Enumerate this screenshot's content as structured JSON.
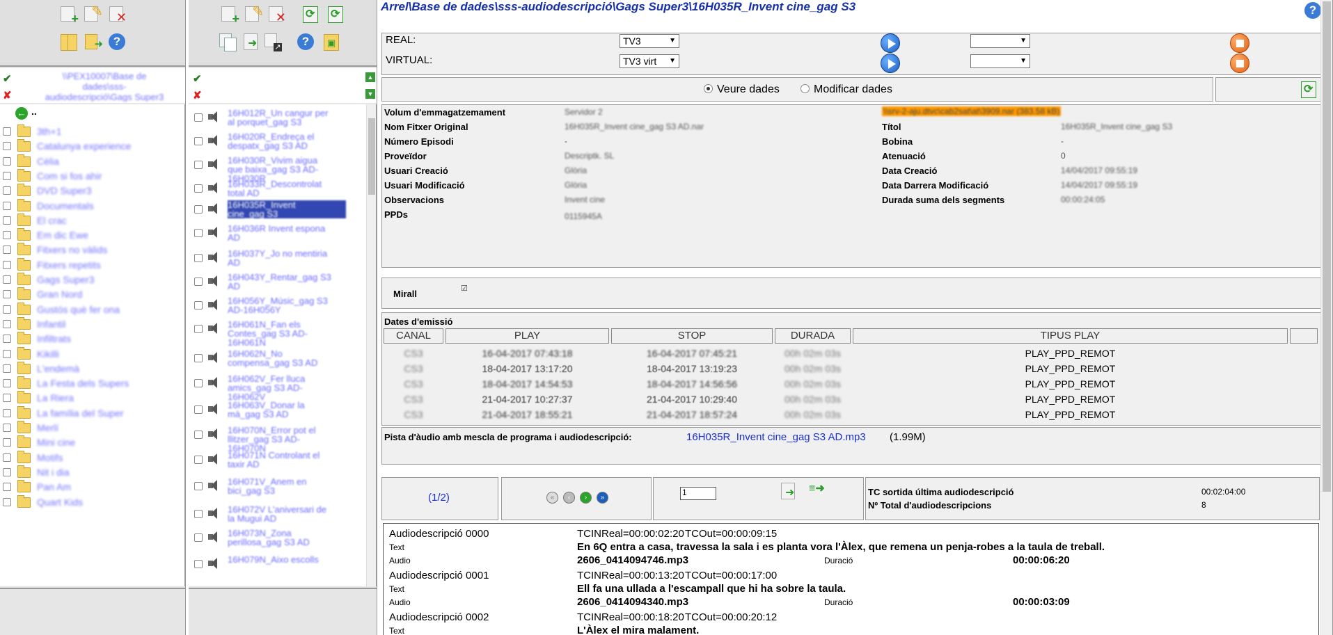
{
  "p1": {
    "root_path": "\\\\PEX10007\\Base de dades\\sss-audiodescripció\\Gags Super3",
    "back": "..",
    "folders": [
      "3th+1",
      "Catalunya experience",
      "Cèlia",
      "Com si fos ahir",
      "DVD Super3",
      "Documentals",
      "El crac",
      "Em dic Ewe",
      "Fitxers no vàlids",
      "Fitxers repetits",
      "Gags Super3",
      "Gran Nord",
      "Gustós què fer ona",
      "Infantil",
      "Infiltrats",
      "Kikilli",
      "L'endemà",
      "La Festa dels Supers",
      "La Riera",
      "La família del Super",
      "Merlí",
      "Mini cine",
      "Motifs",
      "Nit i dia",
      "Pan Am",
      "Quart Kids"
    ]
  },
  "p2": {
    "files": [
      {
        "lines": [
          "16H012R_Un cangur per",
          "al porquet_gag S3"
        ]
      },
      {
        "lines": [
          "16H020R_Endreça el",
          "despatx_gag S3 AD"
        ]
      },
      {
        "lines": [
          "16H030R_Vivim aigua",
          "que baixa_gag S3 AD-",
          "16H030R"
        ]
      },
      {
        "lines": [
          "16H033R_Descontrolat",
          "total AD"
        ]
      },
      {
        "lines": [
          "16H035R_Invent",
          "cine_gag S3"
        ],
        "selected": true
      },
      {
        "lines": [
          "16H036R Invent espona",
          "AD"
        ]
      },
      {
        "lines": [
          "16H037Y_Jo no mentiria",
          "AD"
        ]
      },
      {
        "lines": [
          "16H043Y_Rentar_gag S3",
          "AD"
        ]
      },
      {
        "lines": [
          "16H056Y_Músic_gag S3",
          "AD-16H056Y"
        ]
      },
      {
        "lines": [
          "16H061N_Fan els",
          "Contes_gag S3 AD-",
          "16H061N"
        ]
      },
      {
        "lines": [
          "16H062N_No",
          "compensa_gag S3 AD"
        ]
      },
      {
        "lines": [
          "16H062V_Fer lluca",
          "amics_gag S3 AD-",
          "16H062V"
        ]
      },
      {
        "lines": [
          "16H063V_Donar la",
          "mà_gag S3 AD"
        ]
      },
      {
        "lines": [
          "16H070N_Error pot el",
          "llitzer_gag S3 AD-",
          "16H070N"
        ]
      },
      {
        "lines": [
          "16H071N Controlant el",
          "taxir AD"
        ]
      },
      {
        "lines": [
          "16H071V_Anem en",
          "bici_gag S3"
        ]
      },
      {
        "lines": [
          "16H072V L'aniversari de",
          "la Mugui AD"
        ]
      },
      {
        "lines": [
          "16H073N_Zona",
          "perillosa_gag S3 AD"
        ]
      },
      {
        "lines": [
          "16H079N_Aixo escolls"
        ]
      }
    ]
  },
  "p3": {
    "breadcrumb": "Arrel\\Base de dades\\sss-audiodescripció\\Gags Super3\\16H035R_Invent cine_gag S3",
    "real_label": "REAL:",
    "real_channel": "TV3",
    "real_select2": "",
    "virtual_label": "VIRTUAL:",
    "virtual_channel": "TV3 virt",
    "virtual_select2": "",
    "view_data": "Veure dades",
    "modify_data": "Modificar dades",
    "fields_left": [
      {
        "k": "Volum d'emmagatzemament",
        "v": "Servidor 2",
        "blur": true
      },
      {
        "k": "Nom Fitxer Original",
        "v": "16H035R_Invent cine_gag S3 AD.nar",
        "blur": true
      },
      {
        "k": "Número Episodi",
        "v": "-",
        "blur": false
      },
      {
        "k": "Proveïdor",
        "v": "Descriptk. SL",
        "blur": true
      },
      {
        "k": "Usuari Creació",
        "v": "Glòria",
        "blur": true
      },
      {
        "k": "Usuari Modificació",
        "v": "Glòria",
        "blur": true
      },
      {
        "k": "Observacions",
        "v": "Invent cine",
        "blur": true
      },
      {
        "k": "PPDs",
        "v": "0115945A",
        "blur": true
      }
    ],
    "volume_path": "\\\\srv-2-aju.dtvc\\cab2sat\\at\\3909.nar (383.58 kB)",
    "fields_right": [
      {
        "k": "Títol",
        "v": "16H035R_Invent cine_gag S3",
        "blur": true
      },
      {
        "k": "Bobina",
        "v": "-",
        "blur": false
      },
      {
        "k": "Atenuació",
        "v": "0",
        "blur": false
      },
      {
        "k": "Data Creació",
        "v": "14/04/2017 09:55:19",
        "blur": true
      },
      {
        "k": "Data Darrera Modificació",
        "v": "14/04/2017 09:55:19",
        "blur": true
      },
      {
        "k": "Durada suma dels segments",
        "v": "00:00:24:05",
        "blur": true
      }
    ],
    "mirall": "Mirall",
    "emission_title": "Dates d'emissió",
    "emission_headers": [
      "CANAL",
      "PLAY",
      "STOP",
      "DURADA",
      "TIPUS PLAY",
      ""
    ],
    "emissions": [
      {
        "canal": "CS3",
        "play": "16-04-2017 07:43:18",
        "stop": "16-04-2017 07:45:21",
        "durada": "00h 02m 03s",
        "tipus": "PLAY_PPD_REMOT"
      },
      {
        "canal": "CS3",
        "play": "18-04-2017 13:17:20",
        "stop": "18-04-2017 13:19:23",
        "durada": "00h 02m 03s",
        "tipus": "PLAY_PPD_REMOT"
      },
      {
        "canal": "CS3",
        "play": "18-04-2017 14:54:53",
        "stop": "18-04-2017 14:56:56",
        "durada": "00h 02m 03s",
        "tipus": "PLAY_PPD_REMOT"
      },
      {
        "canal": "CS3",
        "play": "21-04-2017 10:27:37",
        "stop": "21-04-2017 10:29:40",
        "durada": "00h 02m 03s",
        "tipus": "PLAY_PPD_REMOT"
      },
      {
        "canal": "CS3",
        "play": "21-04-2017 18:55:21",
        "stop": "21-04-2017 18:57:24",
        "durada": "00h 02m 03s",
        "tipus": "PLAY_PPD_REMOT"
      }
    ],
    "track_label": "Pista d'àudio amb mescla de programa i audiodescripció:",
    "track_link": "16H035R_Invent cine_gag S3 AD.mp3",
    "track_size": "(1.99M)",
    "pager": "(1/2)",
    "page_input": "1",
    "tc_label": "TC sortida última audiodescripció",
    "tc_value": "00:02:04:00",
    "total_label": "Nº Total d'audiodescripcions",
    "total_value": "8",
    "ads": [
      {
        "title": "Audiodescripció 0000",
        "tcin": "TCINReal=00:00:02:20",
        "tcout": "TCOut=00:00:09:15",
        "text_label": "Text",
        "text": "En 6Q entra a casa, travessa la sala i es planta vora l'Àlex, que remena un penja-robes a la taula de treball.",
        "audio_label": "Audio",
        "audio": "2606_0414094746.mp3",
        "dur_label": "Duració",
        "dur": "00:00:06:20"
      },
      {
        "title": "Audiodescripció 0001",
        "tcin": "TCINReal=00:00:13:20",
        "tcout": "TCOut=00:00:17:00",
        "text_label": "Text",
        "text": "Ell fa una ullada a l'escampall que hi ha sobre la taula.",
        "audio_label": "Audio",
        "audio": "2606_0414094340.mp3",
        "dur_label": "Duració",
        "dur": "00:00:03:09"
      },
      {
        "title": "Audiodescripció 0002",
        "tcin": "TCINReal=00:00:18:20",
        "tcout": "TCOut=00:00:20:12",
        "text_label": "Text",
        "text": "L'Àlex el mira malament.",
        "audio_label": "",
        "audio": "",
        "dur_label": "",
        "dur": ""
      }
    ]
  }
}
